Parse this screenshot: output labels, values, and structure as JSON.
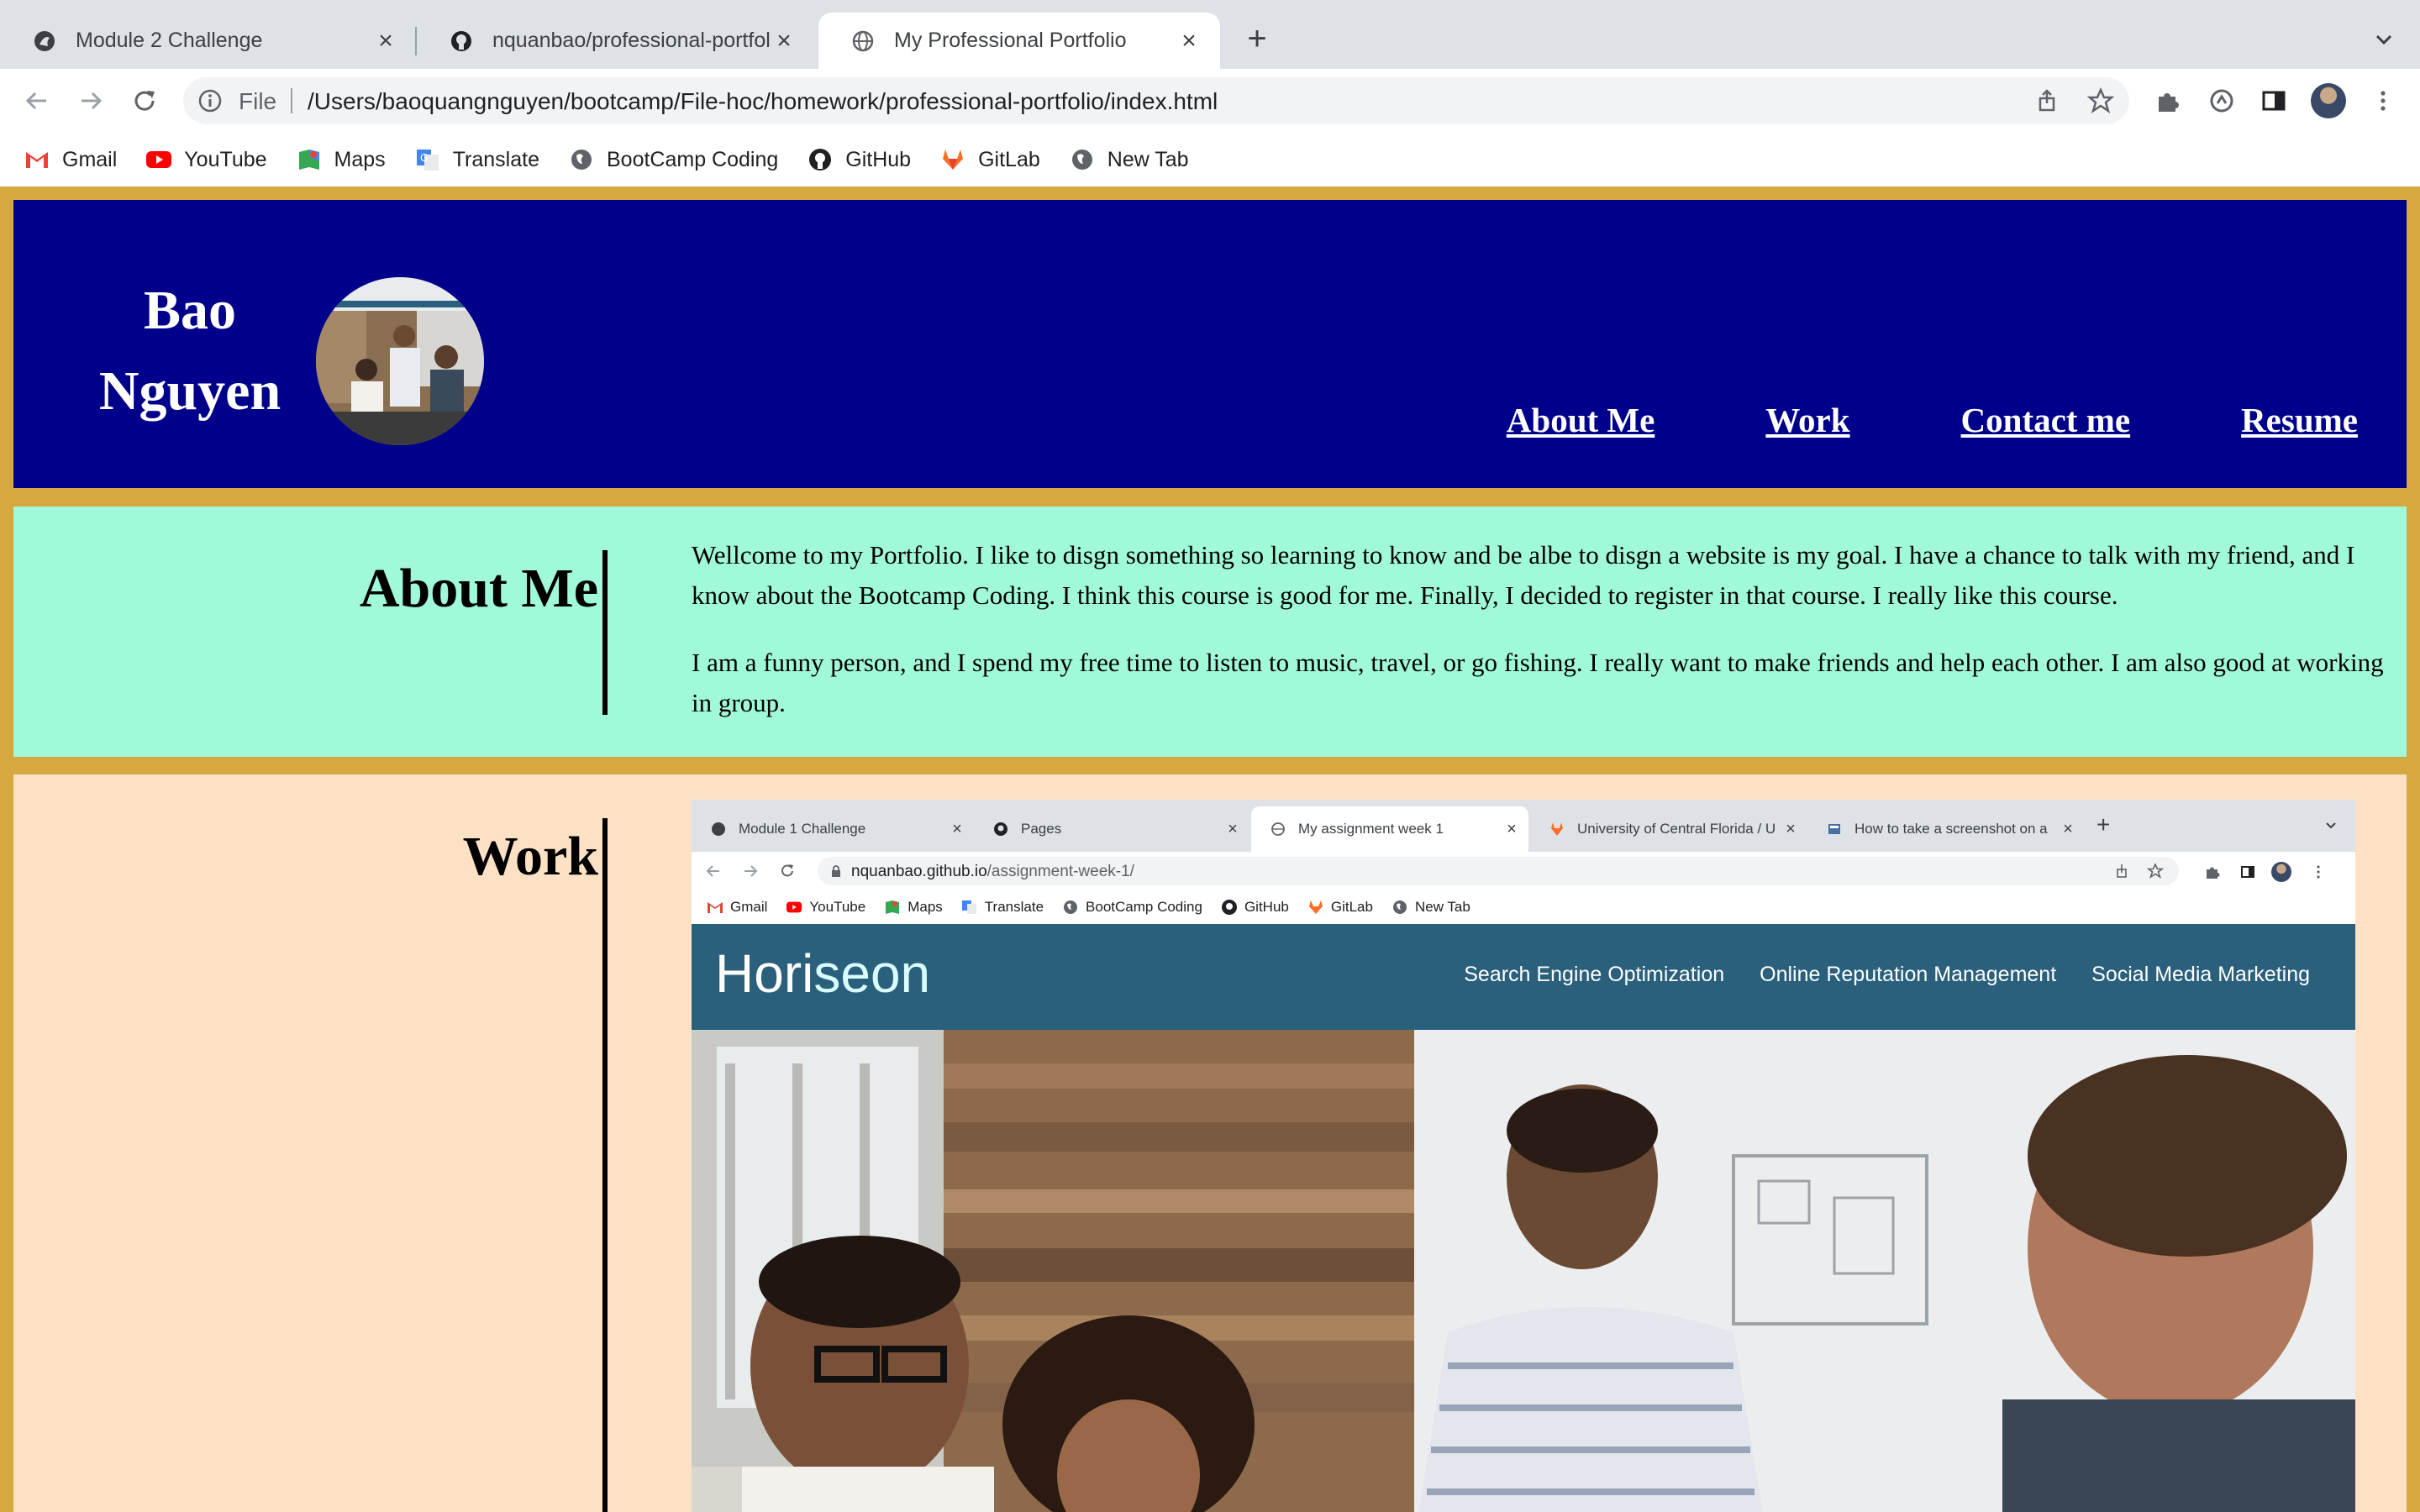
{
  "browser": {
    "tabs": [
      {
        "title": "Module 2 Challenge",
        "icon": "github-pages-icon",
        "active": false
      },
      {
        "title": "nquanbao/professional-portfolio",
        "icon": "github-icon",
        "active": false
      },
      {
        "title": "My Professional Portfolio",
        "icon": "globe-icon",
        "active": true
      }
    ],
    "address": {
      "scheme_label": "File",
      "url": "/Users/baoquangnguyen/bootcamp/File-hoc/homework/professional-portfolio/index.html"
    },
    "bookmarks": [
      {
        "label": "Gmail",
        "icon": "gmail-icon"
      },
      {
        "label": "YouTube",
        "icon": "youtube-icon"
      },
      {
        "label": "Maps",
        "icon": "maps-icon"
      },
      {
        "label": "Translate",
        "icon": "translate-icon"
      },
      {
        "label": "BootCamp Coding",
        "icon": "globe-icon"
      },
      {
        "label": "GitHub",
        "icon": "github-icon"
      },
      {
        "label": "GitLab",
        "icon": "gitlab-icon"
      },
      {
        "label": "New Tab",
        "icon": "globe-icon"
      }
    ]
  },
  "site": {
    "name_line1": "Bao",
    "name_line2": "Nguyen",
    "nav": [
      "About Me",
      "Work",
      "Contact me",
      "Resume"
    ],
    "colors": {
      "header_bg": "#00008b",
      "page_border": "#d6a840",
      "about_bg": "#a0f9d8",
      "work_bg": "#fde1c5"
    },
    "about": {
      "heading": "About Me",
      "paragraphs": [
        "Wellcome to my Portfolio. I like to disgn something so learning to know and be albe to disgn a website is my goal. I have a chance to talk with my friend, and I know about the Bootcamp Coding. I think this course is good for me. Finally, I decided to register in that course. I really like this course.",
        "I am a funny person, and I spend my free time to listen to music, travel, or go fishing. I really want to make friends and help each other. I am also good at working in group."
      ]
    },
    "work": {
      "heading": "Work",
      "screenshot": {
        "tabs": [
          {
            "title": "Module 1 Challenge",
            "icon": "github-pages-icon",
            "active": false
          },
          {
            "title": "Pages",
            "icon": "github-icon",
            "active": false
          },
          {
            "title": "My assignment week 1",
            "icon": "globe-icon",
            "active": true
          },
          {
            "title": "University of Central Florida / U",
            "icon": "gitlab-icon",
            "active": false
          },
          {
            "title": "How to take a screenshot on a",
            "icon": "site-icon",
            "active": false
          }
        ],
        "url_host": "nquanbao.github.io",
        "url_path": "/assignment-week-1/",
        "bookmarks": [
          "Gmail",
          "YouTube",
          "Maps",
          "Translate",
          "BootCamp Coding",
          "GitHub",
          "GitLab",
          "New Tab"
        ],
        "logo_main": "Hori",
        "logo_light": "seon",
        "nav": [
          "Search Engine Optimization",
          "Online Reputation Management",
          "Social Media Marketing"
        ],
        "colors": {
          "header_bg": "#2a607c"
        }
      }
    }
  }
}
